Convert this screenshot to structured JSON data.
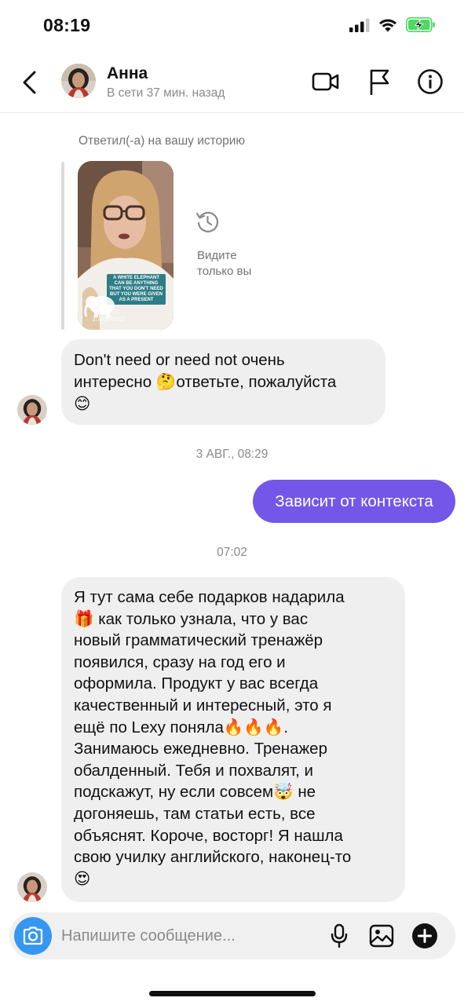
{
  "status_bar": {
    "time": "08:19",
    "battery_charging": true
  },
  "header": {
    "contact_name": "Анна",
    "contact_status": "В сети 37 мин. назад",
    "icons": [
      "chevron-left-icon",
      "video-camera-icon",
      "flag-icon",
      "info-icon"
    ]
  },
  "chat": {
    "story_reply_label": "Ответил(-а) на вашу историю",
    "story_caption": "A WHITE ELEPHANT CAN BE ANYTHING THAT YOU DON'T NEED BUT YOU WERE GIVEN AS A PRESENT",
    "story_watermark": "Elephant",
    "only_you_text": "Видите только вы",
    "messages": [
      {
        "from": "them",
        "text": "Don't need or need not очень интересно 🤔ответьте, пожалуйста 😊"
      },
      {
        "timestamp": "3 АВГ., 08:29"
      },
      {
        "from": "me",
        "text": "Зависит от контекста"
      },
      {
        "timestamp": "07:02"
      },
      {
        "from": "them",
        "text": "Я тут сама себе подарков надарила 🎁 как только узнала, что у вас новый грамматический тренажёр появился, сразу на год его и оформила. Продукт у вас всегда качественный и интересный, это я ещё по Lexy поняла🔥🔥🔥. Занимаюсь ежедневно. Тренажер обалденный. Тебя и похвалят, и подскажут,   ну если совсем🤯 не догоняешь, там статьи есть, все объяснят. Короче, восторг! Я нашла свою училку английского, наконец-то 😍"
      }
    ],
    "msg1_lines": [
      "Don't need or need not очень",
      "интересно 🤔ответьте, пожалуйста",
      "😊"
    ],
    "ts1": "3 АВГ., 08:29",
    "msg2": "Зависит от контекста",
    "ts2": "07:02",
    "msg3_lines": [
      "Я тут сама себе подарков надарила",
      "🎁 как только узнала, что у вас",
      "новый грамматический тренажёр",
      "появился, сразу на год его и",
      "оформила. Продукт у вас всегда",
      "качественный и интересный, это я",
      "ещё по Lexy поняла🔥🔥🔥.",
      "Занимаюсь ежедневно. Тренажер",
      "обалденный. Тебя и похвалят, и",
      "подскажут,   ну если совсем🤯 не",
      "догоняешь, там статьи есть, все",
      "объяснят. Короче, восторг! Я нашла",
      "свою училку английского, наконец-то",
      "😍"
    ]
  },
  "composer": {
    "placeholder": "Напишите сообщение...",
    "icons": [
      "camera-icon",
      "microphone-icon",
      "image-icon",
      "plus-icon"
    ]
  },
  "colors": {
    "outgoing_bubble": "#7357e8",
    "incoming_bubble": "#efefef",
    "camera_button": "#3797f0",
    "battery": "#4cd964"
  }
}
